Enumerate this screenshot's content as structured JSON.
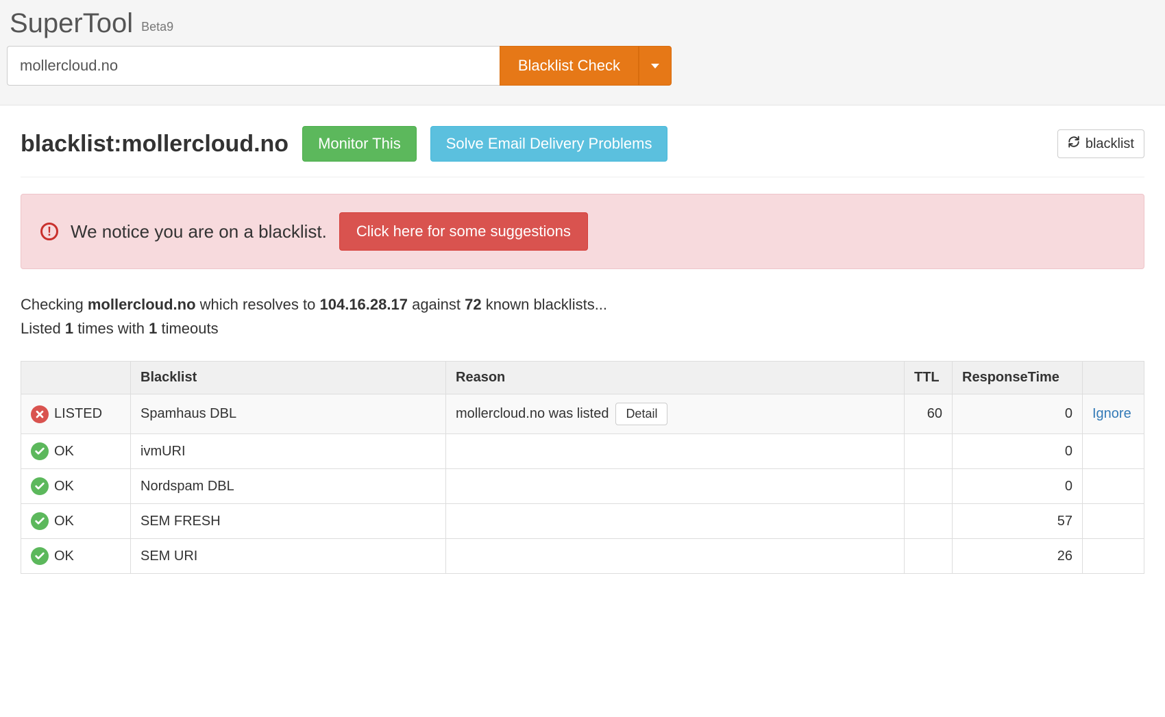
{
  "header": {
    "title": "SuperTool",
    "badge": "Beta9"
  },
  "search": {
    "value": "mollercloud.no",
    "button_label": "Blacklist Check"
  },
  "result": {
    "title": "blacklist:mollercloud.no",
    "monitor_label": "Monitor This",
    "solve_label": "Solve Email Delivery Problems",
    "refresh_label": "blacklist"
  },
  "alert": {
    "text": "We notice you are on a blacklist.",
    "button_label": "Click here for some suggestions"
  },
  "summary": {
    "prefix": "Checking ",
    "hostname": "mollercloud.no",
    "mid1": " which resolves to ",
    "ip": "104.16.28.17",
    "mid2": " against ",
    "total": "72",
    "suffix1": " known blacklists...",
    "line2_prefix": "Listed ",
    "listed_count": "1",
    "line2_mid": " times with ",
    "timeout_count": "1",
    "line2_suffix": " timeouts"
  },
  "table": {
    "headers": {
      "status": "",
      "blacklist": "Blacklist",
      "reason": "Reason",
      "ttl": "TTL",
      "response_time": "ResponseTime",
      "action": ""
    },
    "detail_label": "Detail",
    "ignore_label": "Ignore",
    "rows": [
      {
        "status": "LISTED",
        "ok": false,
        "blacklist": "Spamhaus DBL",
        "reason": "mollercloud.no was listed",
        "has_detail": true,
        "ttl": "60",
        "response_time": "0",
        "action": "Ignore"
      },
      {
        "status": "OK",
        "ok": true,
        "blacklist": "ivmURI",
        "reason": "",
        "has_detail": false,
        "ttl": "",
        "response_time": "0",
        "action": ""
      },
      {
        "status": "OK",
        "ok": true,
        "blacklist": "Nordspam DBL",
        "reason": "",
        "has_detail": false,
        "ttl": "",
        "response_time": "0",
        "action": ""
      },
      {
        "status": "OK",
        "ok": true,
        "blacklist": "SEM FRESH",
        "reason": "",
        "has_detail": false,
        "ttl": "",
        "response_time": "57",
        "action": ""
      },
      {
        "status": "OK",
        "ok": true,
        "blacklist": "SEM URI",
        "reason": "",
        "has_detail": false,
        "ttl": "",
        "response_time": "26",
        "action": ""
      }
    ]
  }
}
